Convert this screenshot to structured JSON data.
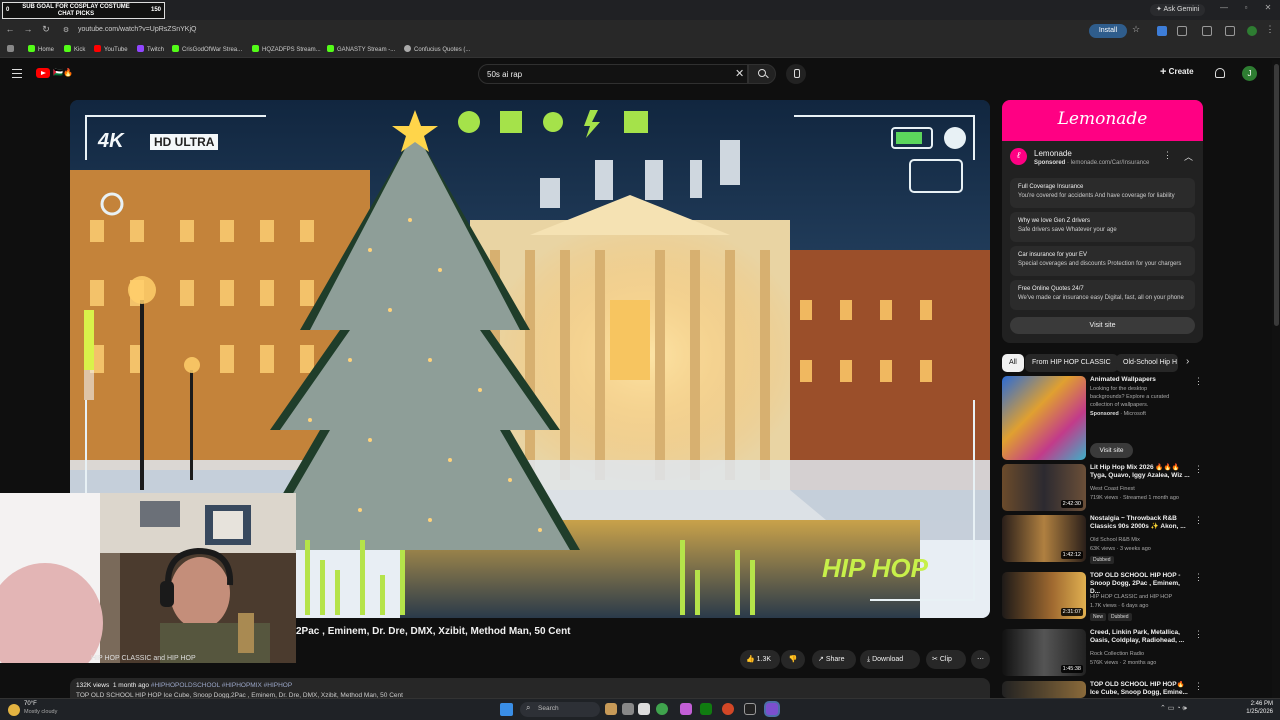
{
  "overlay": {
    "left_num": "0",
    "goal_text": "SUB GOAL FOR COSPLAY COSTUME\nCHAT PICKS",
    "right_num": "150"
  },
  "browser": {
    "ask_gemini": "Ask Gemini",
    "url": "youtube.com/watch?v=UpRsZSnYKjQ",
    "install_label": "Install",
    "bookmarks": [
      "Home",
      "Kick",
      "YouTube",
      "Twitch",
      "CrisGodOfWar Strea...",
      "HQZADFPS Stream...",
      "GANASTY Stream -...",
      "Confucius Quotes (..."
    ]
  },
  "youtube": {
    "logo_text": "🇵🇸🔥",
    "search_value": "50s ai rap",
    "create_label": "Create",
    "avatar_letter": "J"
  },
  "video": {
    "overlay_quality": "HD ULTRA",
    "overlay_4k": "4K",
    "overlay_hiphop": "HIP HOP",
    "title": "2Pac , Eminem, Dr. Dre, DMX, Xzibit, Method Man, 50 Cent",
    "channel_name": "HIP HOP CLASSIC and HIP HOP",
    "like_count": "1.3K",
    "share_label": "Share",
    "download_label": "Download",
    "clip_label": "Clip",
    "views": "132K views",
    "age": "1 month ago",
    "tags": "#HIPHOPOLDSCHOOL #HIPHOPMIX #HIPHOP",
    "desc_line": "TOP OLD SCHOOL HIP HOP Ice Cube, Snoop Dogg,2Pac , Eminem, Dr. Dre, DMX, Xzibit, Method Man, 50 Cent"
  },
  "ad": {
    "brand_banner": "Lemonade",
    "advertiser": "Lemonade",
    "sponsored": "Sponsored",
    "domain": "lemonade.com/Car/Insurance",
    "options": [
      {
        "head": "Full Coverage Insurance",
        "sub": "You're covered for accidents And have coverage for liability"
      },
      {
        "head": "Why we love Gen Z drivers",
        "sub": "Safe drivers save Whatever your age"
      },
      {
        "head": "Car insurance for your EV",
        "sub": "Special coverages and discounts Protection for your chargers"
      },
      {
        "head": "Free Online Quotes 24/7",
        "sub": "We've made car insurance easy Digital, fast, all on your phone"
      }
    ],
    "visit_label": "Visit site"
  },
  "chips": [
    "All",
    "From HIP HOP CLASSIC",
    "Old-School Hip H"
  ],
  "recs": [
    {
      "title": "Animated Wallpapers",
      "line1": "Looking for the desktop",
      "line2": "backgrounds? Explore a curated",
      "line3": "collection of wallpapers.",
      "sponsor": "Sponsored",
      "sponsor_by": "· Microsoft",
      "cta": "Visit site"
    },
    {
      "title": "Lit Hip Hop Mix 2026 🔥🔥🔥 Tyga, Quavo, Iggy Azalea, Wiz ...",
      "channel": "West Coast Finest",
      "meta": "719K views · Streamed 1 month ago",
      "dur": "2:42:30"
    },
    {
      "title": "Nostalgia ~ Throwback R&B Classics 90s 2000s ✨ Akon, ...",
      "channel": "Old School R&B Mix",
      "meta": "63K views · 3 weeks ago",
      "badge": "Dubbed",
      "dur": "1:42:12"
    },
    {
      "title": "TOP OLD SCHOOL HIP HOP - Snoop Dogg, 2Pac , Eminem, D...",
      "channel": "HIP HOP CLASSIC and HIP HOP",
      "meta": "1.7K views · 6 days ago",
      "badge1": "New",
      "badge2": "Dubbed",
      "dur": "2:31:07"
    },
    {
      "title": "Creed, Linkin Park, Metallica, Oasis, Coldplay, Radiohead, ...",
      "channel": "Rock Collection Radio",
      "meta": "576K views · 2 months ago",
      "dur": "1:45:38"
    },
    {
      "title": "TOP OLD SCHOOL HIP HOP🔥 Ice Cube, Snoop Dogg, Emine...",
      "channel": "",
      "meta": "",
      "dur": ""
    }
  ],
  "taskbar": {
    "weather_temp": "70°F",
    "weather_desc": "Mostly cloudy",
    "search_label": "Search",
    "time": "2:46 PM",
    "date": "1/25/2026"
  },
  "colors": {
    "yt_bg": "#0f0f0f",
    "lemonade_pink": "#ff0083",
    "yt_red": "#ff0000"
  }
}
